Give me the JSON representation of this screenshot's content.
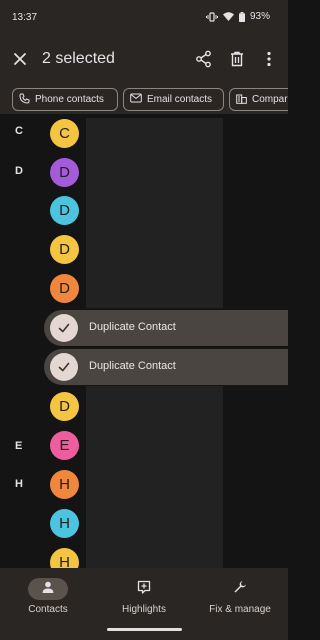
{
  "status_bar": {
    "time": "13:37",
    "battery": "93%",
    "icons": [
      "vibrate-icon",
      "wifi-icon",
      "battery-icon"
    ]
  },
  "app_bar": {
    "title": "2 selected",
    "icons": [
      "close-icon",
      "share-icon",
      "delete-icon",
      "more-vert-icon"
    ]
  },
  "filter_chips": [
    {
      "label": "Phone contacts",
      "icon": "phone-icon"
    },
    {
      "label": "Email contacts",
      "icon": "email-icon"
    },
    {
      "label": "Compar",
      "icon": "company-icon"
    }
  ],
  "contact_list": {
    "section_letters": [
      "C",
      "D",
      "E",
      "H"
    ],
    "avatars": [
      {
        "initial": "C",
        "color": "#f5c542"
      },
      {
        "initial": "D",
        "color": "#a35bd9"
      },
      {
        "initial": "D",
        "color": "#4cc4e0"
      },
      {
        "initial": "D",
        "color": "#f5c542"
      },
      {
        "initial": "D",
        "color": "#f0873d"
      },
      {
        "initial": "D",
        "color": "#f5c542"
      },
      {
        "initial": "E",
        "color": "#ee5d9d"
      },
      {
        "initial": "H",
        "color": "#f0873d"
      },
      {
        "initial": "H",
        "color": "#4cc4e0"
      },
      {
        "initial": "H",
        "color": "#f5c542"
      }
    ],
    "selected_rows": [
      {
        "name": "Duplicate Contact"
      },
      {
        "name": "Duplicate Contact"
      }
    ]
  },
  "bottom_nav": [
    {
      "label": "Contacts",
      "icon": "person-icon",
      "active": true
    },
    {
      "label": "Highlights",
      "icon": "highlights-icon",
      "active": false
    },
    {
      "label": "Fix & manage",
      "icon": "wrench-icon",
      "active": false
    }
  ],
  "colors": {
    "surface": "#2a2623",
    "background": "#141414",
    "selected_row": "#4a4541",
    "active_pill": "#5a524b"
  }
}
